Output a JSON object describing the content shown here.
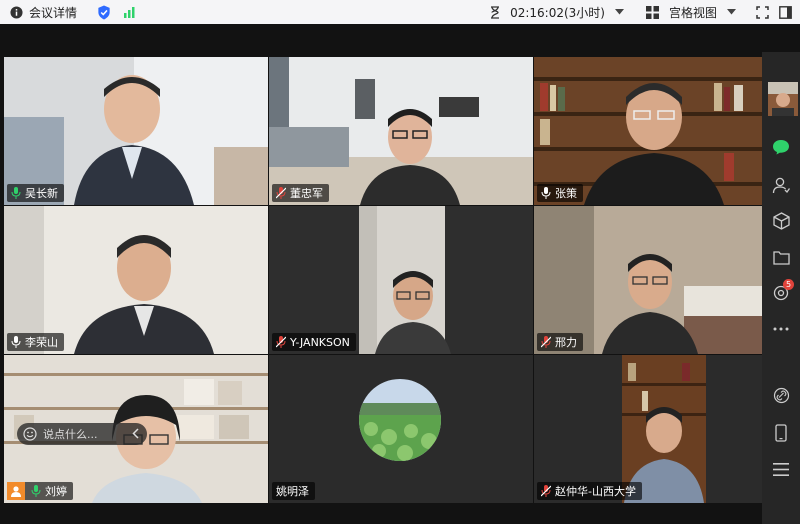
{
  "topbar": {
    "meeting_info": "会议详情",
    "timer": "02:16:02(3小时)",
    "view_mode": "宫格视图"
  },
  "participants": [
    {
      "name": "吴长新",
      "mic": "on"
    },
    {
      "name": "董忠军",
      "mic": "muted"
    },
    {
      "name": "张策",
      "mic": "on"
    },
    {
      "name": "李荣山",
      "mic": "on"
    },
    {
      "name": "Y-JANKSON",
      "mic": "muted"
    },
    {
      "name": "邢力",
      "mic": "muted"
    },
    {
      "name": "刘婷",
      "mic": "on"
    },
    {
      "name": "姚明泽",
      "mic": "none"
    },
    {
      "name": "赵仲华-山西大学",
      "mic": "muted"
    }
  ],
  "chat": {
    "placeholder": "说点什么..."
  },
  "sidebar": {
    "badge": "5"
  },
  "colors": {
    "green": "#2fd26b",
    "red": "#e0433b",
    "blue": "#2f6bff"
  }
}
